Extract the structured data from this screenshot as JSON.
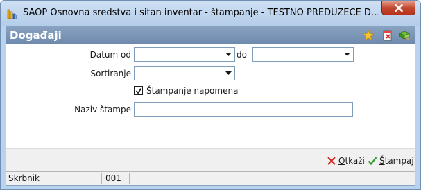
{
  "window": {
    "title": "SAOP Osnovna sredstva i sitan inventar - štampanje  - TESTNO PREDUZEĆE D..."
  },
  "header": {
    "title": "Događaji",
    "icons": [
      "star-icon",
      "page-delete-icon",
      "book-icon"
    ]
  },
  "form": {
    "date_from_label": "Datum od",
    "date_from_value": "",
    "date_to_label": "do",
    "date_to_value": "",
    "sort_label": "Sortiranje",
    "sort_value": "",
    "print_notes_label": "Štampanje napomena",
    "print_notes_checked": true,
    "print_name_label": "Naziv štampe",
    "print_name_value": ""
  },
  "buttons": {
    "cancel_mnemonic": "O",
    "cancel_rest": "tkaži",
    "print_mnemonic": "Š",
    "print_rest": "tampaj"
  },
  "status": {
    "field_label": "Skrbnik",
    "field_value": "001"
  },
  "colors": {
    "title_bar": "#b9d3ee",
    "header_bar": "#7a95b7",
    "close_button": "#c44a31",
    "cancel_icon": "#d0281e",
    "print_icon": "#2f9a2f"
  }
}
